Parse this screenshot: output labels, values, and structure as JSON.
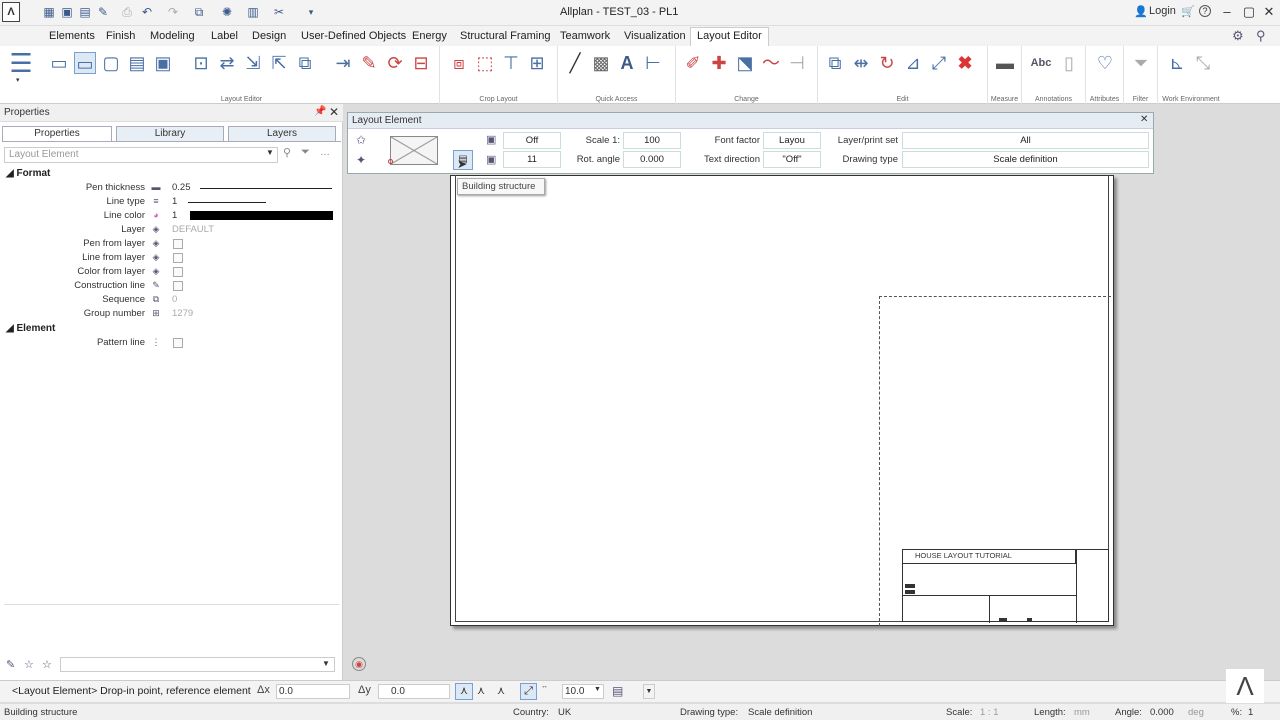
{
  "app": {
    "title": "Allplan - TEST_03 - PL1",
    "logo": "Λ",
    "login": "Login",
    "help": "?"
  },
  "tabs": [
    "Elements",
    "Finish",
    "Modeling",
    "Label",
    "Design",
    "User-Defined Objects",
    "Energy",
    "Structural Framing",
    "Teamwork",
    "Visualization",
    "Layout Editor"
  ],
  "ribbon_groups": [
    "Layout Editor",
    "Crop Layout",
    "Quick Access",
    "Change",
    "Edit",
    "Measure",
    "Annotations",
    "Attributes",
    "Filter",
    "Work Environment"
  ],
  "properties": {
    "title": "Properties",
    "tabs": [
      "Properties",
      "Library",
      "Layers"
    ],
    "combo": "Layout Element",
    "format_section": "Format",
    "element_section": "Element",
    "rows": [
      {
        "label": "Pen thickness",
        "value": "0.25"
      },
      {
        "label": "Line type",
        "value": "1"
      },
      {
        "label": "Line color",
        "value": "1"
      },
      {
        "label": "Layer",
        "value": "DEFAULT"
      },
      {
        "label": "Pen from layer",
        "value": ""
      },
      {
        "label": "Line from layer",
        "value": ""
      },
      {
        "label": "Color from layer",
        "value": ""
      },
      {
        "label": "Construction line",
        "value": ""
      },
      {
        "label": "Sequence",
        "value": "0"
      },
      {
        "label": "Group number",
        "value": "1279"
      }
    ],
    "element_rows": [
      {
        "label": "Pattern line",
        "value": ""
      }
    ]
  },
  "dialog": {
    "title": "Layout Element",
    "off": "Off",
    "num11": "11",
    "scale_label": "Scale 1:",
    "scale": "100",
    "rot_label": "Rot. angle",
    "rot": "0.000",
    "font_label": "Font factor",
    "font": "Layou",
    "textdir_label": "Text direction",
    "textdir": "\"Off\"",
    "layer_label": "Layer/print set",
    "layer": "All",
    "dtype_label": "Drawing type",
    "dtype": "Scale definition"
  },
  "tooltip": "Building structure",
  "titleblock": {
    "heading": "HOUSE LAYOUT TUTORIAL"
  },
  "dynbar": {
    "prompt": "<Layout Element> Drop-in point, reference element",
    "dx_label": "Δx",
    "dx": "0.0",
    "dy_label": "Δy",
    "dy": "0.0",
    "step": "10.0"
  },
  "statusbar": {
    "left": "Building structure",
    "country_label": "Country:",
    "country": "UK",
    "dtype_label": "Drawing type:",
    "dtype": "Scale definition",
    "scale_label": "Scale:",
    "scale": "1 : 1",
    "length_label": "Length:",
    "length": "mm",
    "angle_label": "Angle:",
    "angle": "0.000",
    "angle_unit": "deg",
    "pct_label": "%:",
    "pct": "1"
  }
}
